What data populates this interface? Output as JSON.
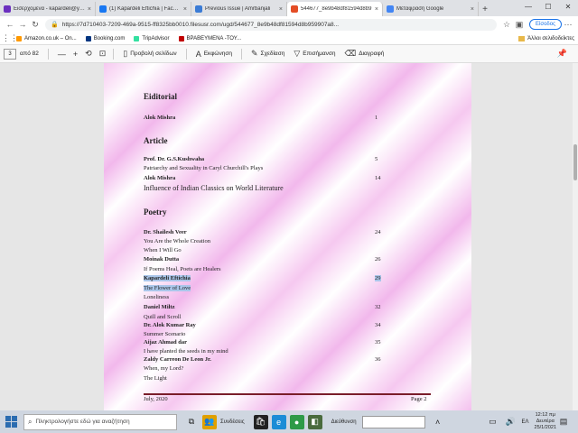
{
  "tabs": [
    {
      "title": "Εισερχόμενα - kapardeli@yahoo.gr",
      "color": "#6b2fbf"
    },
    {
      "title": "(1) Kapardeli Eftichia | Facebook",
      "color": "#1877f2"
    },
    {
      "title": "Previous Issue | Amrbanjali",
      "color": "#3a7bd5"
    },
    {
      "title": "544677_8e9b48df81594d8b9",
      "color": "#e44d26",
      "active": true
    },
    {
      "title": "Μετάφραση Google",
      "color": "#4285f4"
    }
  ],
  "address": {
    "url": "https://7d710403-7209-469a-9515-ff8325bb0010.filesusr.com/ugd/544677_8e9b48df81594d8b959907a8...",
    "signin": "Είσοδος"
  },
  "bookmarks": [
    {
      "label": "Amazon.co.uk – On...",
      "color": "#ff9900"
    },
    {
      "label": "Booking.com",
      "color": "#003580"
    },
    {
      "label": "TripAdvisor",
      "color": "#34e0a1"
    },
    {
      "label": "ΒΡΑΒΕΥΜΕΝΑ -ΤΟΥ...",
      "color": "#c00000"
    }
  ],
  "bookmarks_other": "Άλλοι σελιδοδείκτες",
  "pdf_toolbar": {
    "page": "3",
    "of": "από 82",
    "view_pages": "Προβολή σελίδων",
    "read_aloud": "Εκφώνηση",
    "draw": "Σχεδίαση",
    "highlight": "Επισήμανση",
    "erase": "Διαγραφή"
  },
  "document": {
    "editorial_heading": "Eiditorial",
    "editorial_author": "Alok Mishra",
    "editorial_page": "1",
    "article_heading": "Article",
    "articles": [
      {
        "author": "Prof. Dr. G.S.Kushwaha",
        "title": "Patriarchy and Sexuality in Caryl Churchill's Plays",
        "page": "5"
      },
      {
        "author": "Alok Mishra",
        "title": "Influence of Indian Classics on World Literature",
        "page": "14"
      }
    ],
    "poetry_heading": "Poetry",
    "poetry": [
      {
        "author": "Dr. Shailesh Veer",
        "titles": [
          "You Are the Whole Creation",
          "When I Will Go"
        ],
        "page": "24"
      },
      {
        "author": "Moinak Dutta",
        "titles": [
          "If Poems Heal, Poets are Healers"
        ],
        "page": "26"
      },
      {
        "author": "Kapardeli Eftichia",
        "titles": [
          "The Flower of Love",
          "Loneliness"
        ],
        "page": "29"
      },
      {
        "author": "Daniel Miltz",
        "titles": [
          "Quill and Scroll"
        ],
        "page": "32"
      },
      {
        "author": "Dr. Alok Kumar Ray",
        "titles": [
          "Summer Scenario"
        ],
        "page": "34"
      },
      {
        "author": "Aijaz Ahmad dar",
        "titles": [
          "I have planted the seeds in my mind"
        ],
        "page": "35"
      },
      {
        "author": "Zaldy Carreon De Leon Jr.",
        "titles": [
          "When, my Lord?",
          "The Light"
        ],
        "page": "36"
      }
    ],
    "footer_left": "July, 2020",
    "footer_right": "Page 2"
  },
  "taskbar": {
    "search_placeholder": "Πληκτρολογήστε εδώ για αναζήτηση",
    "weather": "Συνδέσεις",
    "address_label": "Διεύθυνση",
    "lang": "ΕΛ",
    "time": "12:12 πμ",
    "day": "Δευτέρα",
    "date": "25/1/2021"
  }
}
